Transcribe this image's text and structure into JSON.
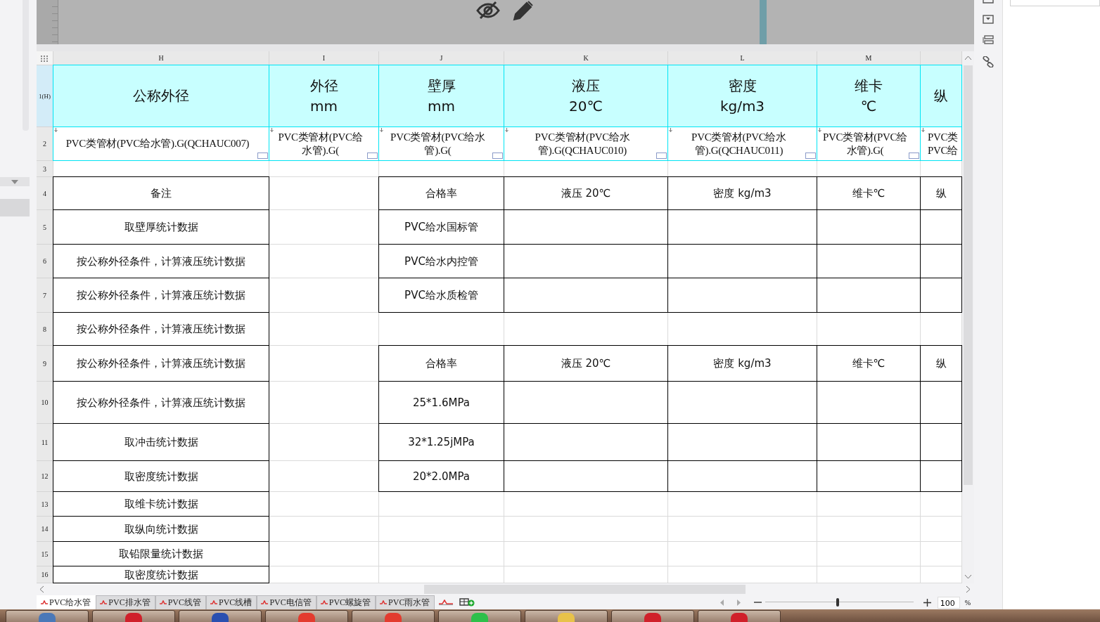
{
  "columns": [
    "H",
    "I",
    "J",
    "K",
    "L",
    "M"
  ],
  "rows": [
    {
      "number": "1(H)",
      "kind": "header",
      "cells": [
        {
          "text": "公称外径"
        },
        {
          "text": "外径\nmm"
        },
        {
          "text": "壁厚\nmm"
        },
        {
          "text": "液压\n20℃"
        },
        {
          "text": "密度\nkg/m3"
        },
        {
          "text": "维卡\n℃"
        },
        {
          "text": "纵"
        }
      ]
    },
    {
      "number": "2",
      "kind": "source",
      "cells": [
        {
          "text": "PVC类管材(PVC给水管).G(QCHAUC007)",
          "note": true
        },
        {
          "text": "PVC类管材(PVC给水管).G(",
          "note": true
        },
        {
          "text": "PVC类管材(PVC给水管).G(",
          "note": true
        },
        {
          "text": "PVC类管材(PVC给水管).G(QCHAUC010)",
          "note": true
        },
        {
          "text": "PVC类管材(PVC给水管).G(QCHAUC011)",
          "note": true
        },
        {
          "text": "PVC类管材(PVC给水管).G(",
          "note": true
        },
        {
          "text": "PVC类PVC给",
          "note": false
        }
      ]
    },
    {
      "number": "3",
      "kind": "blank",
      "cells": [
        {
          "boxed": false
        },
        {
          "boxed": false
        },
        {
          "boxed": false
        },
        {
          "boxed": false
        },
        {
          "boxed": false
        },
        {
          "boxed": false
        },
        {
          "boxed": false
        }
      ]
    },
    {
      "number": "4",
      "kind": "data",
      "cells": [
        {
          "text": "备注",
          "boxed": true
        },
        {
          "boxed": false
        },
        {
          "text": "合格率",
          "boxed": true
        },
        {
          "text": "液压 20℃",
          "boxed": true
        },
        {
          "text": "密度 kg/m3",
          "boxed": true
        },
        {
          "text": "维卡℃",
          "boxed": true
        },
        {
          "text": "纵",
          "boxed": true
        }
      ]
    },
    {
      "number": "5",
      "kind": "data",
      "cells": [
        {
          "text": "取壁厚统计数据",
          "boxed": true
        },
        {
          "boxed": false
        },
        {
          "text": "PVC给水国标管",
          "boxed": true
        },
        {
          "boxed": true
        },
        {
          "boxed": true
        },
        {
          "boxed": true
        },
        {
          "boxed": true
        }
      ]
    },
    {
      "number": "6",
      "kind": "data",
      "cells": [
        {
          "text": "按公称外径条件，计算液压统计数据",
          "boxed": true
        },
        {
          "boxed": false
        },
        {
          "text": "PVC给水内控管",
          "boxed": true
        },
        {
          "boxed": true
        },
        {
          "boxed": true
        },
        {
          "boxed": true
        },
        {
          "boxed": true
        }
      ]
    },
    {
      "number": "7",
      "kind": "data",
      "cells": [
        {
          "text": "按公称外径条件，计算液压统计数据",
          "boxed": true
        },
        {
          "boxed": false
        },
        {
          "text": "PVC给水质检管",
          "boxed": true
        },
        {
          "boxed": true
        },
        {
          "boxed": true
        },
        {
          "boxed": true
        },
        {
          "boxed": true
        }
      ]
    },
    {
      "number": "8",
      "kind": "data",
      "cells": [
        {
          "text": "按公称外径条件，计算液压统计数据",
          "boxed": true
        },
        {
          "boxed": false
        },
        {
          "boxed": false
        },
        {
          "boxed": false
        },
        {
          "boxed": false
        },
        {
          "boxed": false
        },
        {
          "boxed": false
        }
      ]
    },
    {
      "number": "9",
      "kind": "data",
      "cells": [
        {
          "text": "按公称外径条件，计算液压统计数据",
          "boxed": true
        },
        {
          "boxed": false
        },
        {
          "text": "合格率",
          "boxed": true
        },
        {
          "text": "液压 20℃",
          "boxed": true
        },
        {
          "text": "密度 kg/m3",
          "boxed": true
        },
        {
          "text": "维卡℃",
          "boxed": true
        },
        {
          "text": "纵",
          "boxed": true
        }
      ]
    },
    {
      "number": "10",
      "kind": "data",
      "cells": [
        {
          "text": "按公称外径条件，计算液压统计数据",
          "boxed": true
        },
        {
          "boxed": false
        },
        {
          "text": "25*1.6MPa",
          "boxed": true
        },
        {
          "boxed": true
        },
        {
          "boxed": true
        },
        {
          "boxed": true
        },
        {
          "boxed": true
        }
      ]
    },
    {
      "number": "11",
      "kind": "data",
      "cells": [
        {
          "text": "取冲击统计数据",
          "boxed": true
        },
        {
          "boxed": false
        },
        {
          "text": "32*1.25jMPa",
          "boxed": true
        },
        {
          "boxed": true
        },
        {
          "boxed": true
        },
        {
          "boxed": true
        },
        {
          "boxed": true
        }
      ]
    },
    {
      "number": "12",
      "kind": "data",
      "cells": [
        {
          "text": "取密度统计数据",
          "boxed": true
        },
        {
          "boxed": false
        },
        {
          "text": "20*2.0MPa",
          "boxed": true
        },
        {
          "boxed": true
        },
        {
          "boxed": true
        },
        {
          "boxed": true
        },
        {
          "boxed": true
        }
      ]
    },
    {
      "number": "13",
      "kind": "data",
      "cells": [
        {
          "text": "取维卡统计数据",
          "boxed": true
        },
        {
          "boxed": false
        },
        {
          "boxed": false
        },
        {
          "boxed": false
        },
        {
          "boxed": false
        },
        {
          "boxed": false
        },
        {
          "boxed": false
        }
      ]
    },
    {
      "number": "14",
      "kind": "data",
      "cells": [
        {
          "text": "取纵向统计数据",
          "boxed": true
        },
        {
          "boxed": false
        },
        {
          "boxed": false
        },
        {
          "boxed": false
        },
        {
          "boxed": false
        },
        {
          "boxed": false
        },
        {
          "boxed": false
        }
      ]
    },
    {
      "number": "15",
      "kind": "data",
      "cells": [
        {
          "text": "取铅限量统计数据",
          "boxed": true
        },
        {
          "boxed": false
        },
        {
          "boxed": false
        },
        {
          "boxed": false
        },
        {
          "boxed": false
        },
        {
          "boxed": false
        },
        {
          "boxed": false
        }
      ]
    },
    {
      "number": "16",
      "kind": "data",
      "cells": [
        {
          "text": "取密度统计数据",
          "boxed": true
        },
        {
          "boxed": false
        },
        {
          "boxed": false
        },
        {
          "boxed": false
        },
        {
          "boxed": false
        },
        {
          "boxed": false
        },
        {
          "boxed": false
        }
      ]
    }
  ],
  "sheet_tabs": [
    {
      "label": "PVC给水管",
      "selected": true
    },
    {
      "label": "PVC排水管",
      "selected": false
    },
    {
      "label": "PVC线管",
      "selected": false
    },
    {
      "label": "PVC线槽",
      "selected": false
    },
    {
      "label": "PVC电信管",
      "selected": false
    },
    {
      "label": "PVC螺旋管",
      "selected": false
    },
    {
      "label": "PVC雨水管",
      "selected": false
    }
  ],
  "zoom": {
    "level": 0.49,
    "value": "100",
    "unit": "%"
  }
}
